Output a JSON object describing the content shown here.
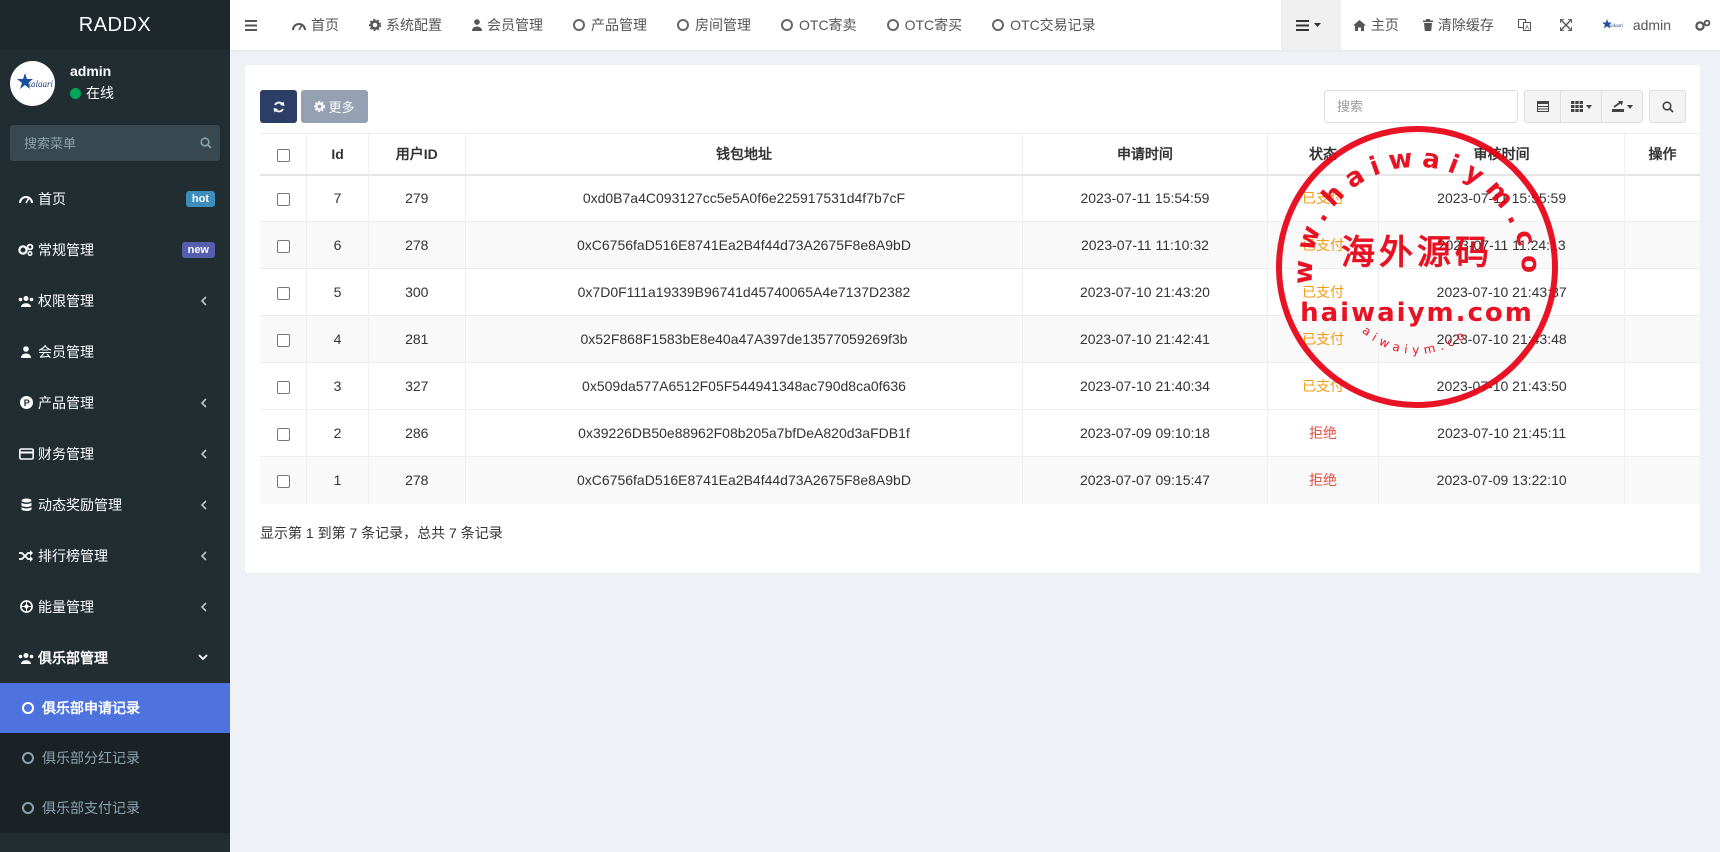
{
  "brand": "RADDX",
  "user": {
    "name": "admin",
    "status": "在线"
  },
  "sidebar": {
    "search_placeholder": "搜索菜单",
    "items": [
      {
        "label": "首页",
        "badge": "hot",
        "icon": "dashboard-icon"
      },
      {
        "label": "常规管理",
        "badge": "new",
        "icon": "cogs-icon"
      },
      {
        "label": "权限管理",
        "icon": "group-icon"
      },
      {
        "label": "会员管理",
        "icon": "user-icon"
      },
      {
        "label": "产品管理",
        "icon": "product-icon"
      },
      {
        "label": "财务管理",
        "icon": "wallet-icon"
      },
      {
        "label": "动态奖励管理",
        "icon": "database-icon"
      },
      {
        "label": "排行榜管理",
        "icon": "random-icon"
      },
      {
        "label": "能量管理",
        "icon": "energy-icon"
      },
      {
        "label": "俱乐部管理",
        "icon": "group-icon"
      }
    ],
    "subitems": [
      {
        "label": "俱乐部申请记录"
      },
      {
        "label": "俱乐部分红记录"
      },
      {
        "label": "俱乐部支付记录"
      }
    ]
  },
  "header": {
    "nav": [
      {
        "label": "首页"
      },
      {
        "label": "系统配置"
      },
      {
        "label": "会员管理"
      },
      {
        "label": "产品管理"
      },
      {
        "label": "房间管理"
      },
      {
        "label": "OTC寄卖"
      },
      {
        "label": "OTC寄买"
      },
      {
        "label": "OTC交易记录"
      }
    ],
    "right": {
      "home": "主页",
      "clear_cache": "清除缓存",
      "user": "admin"
    }
  },
  "toolbar": {
    "more": "更多",
    "search_placeholder": "搜索"
  },
  "table": {
    "headers": [
      "Id",
      "用户ID",
      "钱包地址",
      "申请时间",
      "状态",
      "审核时间",
      "操作"
    ],
    "rows": [
      {
        "id": "7",
        "uid": "279",
        "wallet": "0xd0B7a4C093127cc5e5A0f6e225917531d4f7b7cF",
        "apply": "2023-07-11 15:54:59",
        "status": "已支付",
        "review": "2023-07-11 15:55:59"
      },
      {
        "id": "6",
        "uid": "278",
        "wallet": "0xC6756faD516E8741Ea2B4f44d73A2675F8e8A9bD",
        "apply": "2023-07-11 11:10:32",
        "status": "已支付",
        "review": "2023-07-11 11:24:13"
      },
      {
        "id": "5",
        "uid": "300",
        "wallet": "0x7D0F111a19339B96741d45740065A4e7137D2382",
        "apply": "2023-07-10 21:43:20",
        "status": "已支付",
        "review": "2023-07-10 21:43:37"
      },
      {
        "id": "4",
        "uid": "281",
        "wallet": "0x52F868F1583bE8e40a47A397de13577059269f3b",
        "apply": "2023-07-10 21:42:41",
        "status": "已支付",
        "review": "2023-07-10 21:43:48"
      },
      {
        "id": "3",
        "uid": "327",
        "wallet": "0x509da577A6512F05F544941348ac790d8ca0f636",
        "apply": "2023-07-10 21:40:34",
        "status": "已支付",
        "review": "2023-07-10 21:43:50"
      },
      {
        "id": "2",
        "uid": "286",
        "wallet": "0x39226DB50e88962F08b205a7bfDeA820d3aFDB1f",
        "apply": "2023-07-09 09:10:18",
        "status": "拒绝",
        "review": "2023-07-10 21:45:11"
      },
      {
        "id": "1",
        "uid": "278",
        "wallet": "0xC6756faD516E8741Ea2B4f44d73A2675F8e8A9bD",
        "apply": "2023-07-07 09:15:47",
        "status": "拒绝",
        "review": "2023-07-09 13:22:10"
      }
    ]
  },
  "pagination_info": "显示第 1 到第 7 条记录，总共 7 条记录",
  "watermark": {
    "center": "海外源码",
    "url": "haiwaiym.com",
    "ring": "www.haiwaiym.com",
    "small": "haiwaiym.com"
  },
  "colors": {
    "sidebar_bg": "#222d32",
    "active": "#4e73df",
    "paid": "#f39c12",
    "reject": "#e74c3c",
    "stamp": "#e60012"
  }
}
